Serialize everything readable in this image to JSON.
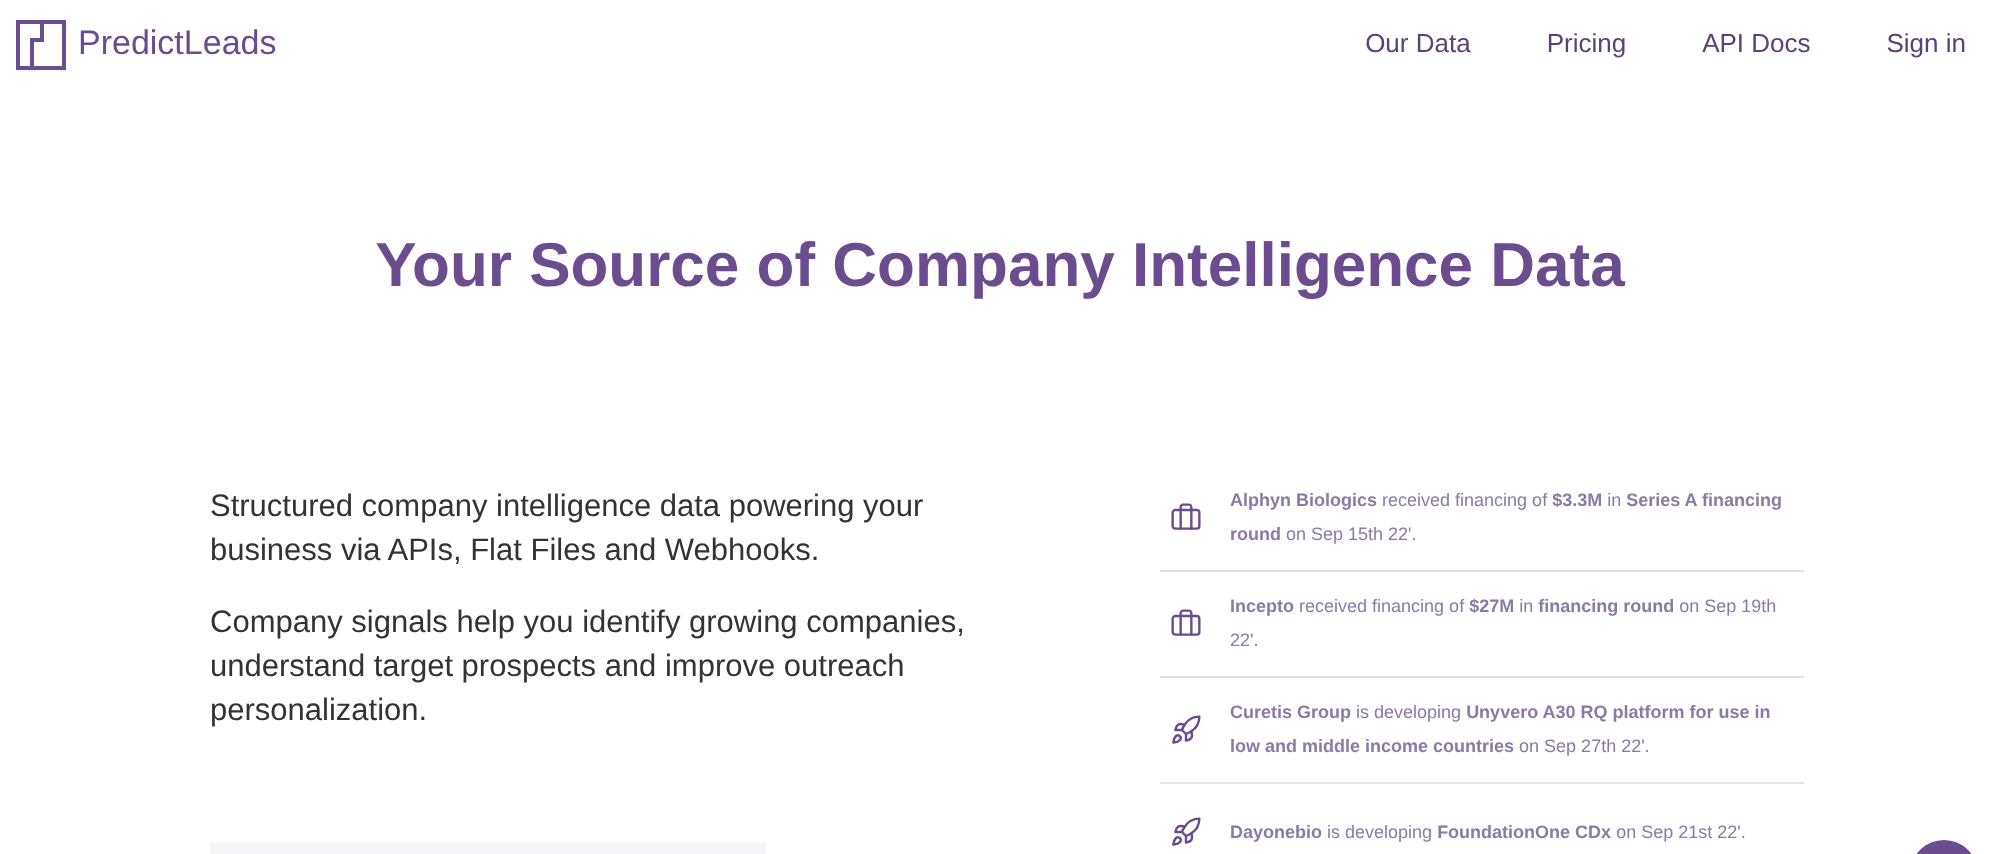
{
  "brand": {
    "name": "PredictLeads"
  },
  "nav": [
    "Our Data",
    "Pricing",
    "API Docs",
    "Sign in"
  ],
  "headline": "Your Source of Company Intelligence Data",
  "paragraphs": [
    "Structured company intelligence data powering your business via APIs, Flat Files and Webhooks.",
    "Company signals help you identify growing companies, understand target prospects and improve outreach personalization."
  ],
  "events": [
    {
      "kind": "funding",
      "text": "**Alphyn Biologics** received financing of **$3.3M** in **Series A financing round** on Sep 15th 22'."
    },
    {
      "kind": "funding",
      "text": "**Incepto** received financing of **$27M** in **financing round** on Sep 19th 22'."
    },
    {
      "kind": "product",
      "text": "**Curetis Group** is developing **Unyvero A30 RQ platform for use in low and middle income countries** on Sep 27th 22'."
    },
    {
      "kind": "product",
      "text": "**Dayonebio** is developing **FoundationOne CDx** on Sep 21st 22'."
    }
  ]
}
